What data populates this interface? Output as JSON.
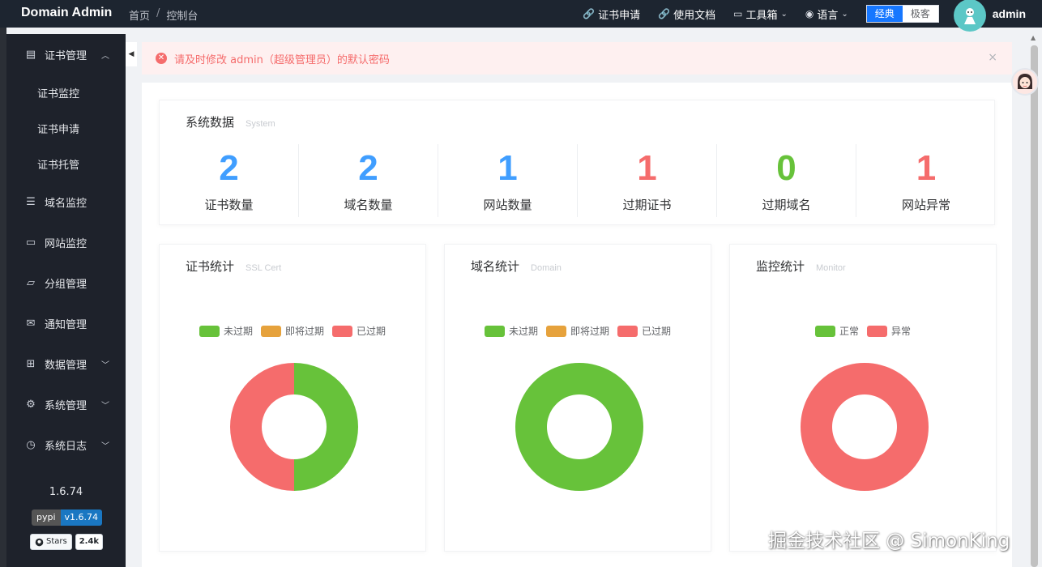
{
  "header": {
    "brand": "Domain Admin",
    "breadcrumbs": [
      "首页",
      "/",
      "控制台"
    ],
    "links": [
      {
        "label": "证书申请",
        "icon": "link-icon"
      },
      {
        "label": "使用文档",
        "icon": "link-icon"
      },
      {
        "label": "工具箱",
        "icon": "toolbox-icon"
      },
      {
        "label": "语言",
        "icon": "location-icon"
      }
    ],
    "mode": {
      "active": "经典",
      "inactive": "极客"
    },
    "username": "admin"
  },
  "sidebar": {
    "items": [
      {
        "label": "证书管理",
        "icon": "document-icon",
        "expanded": true
      },
      {
        "label": "域名监控",
        "icon": "database-icon"
      },
      {
        "label": "网站监控",
        "icon": "monitor-icon"
      },
      {
        "label": "分组管理",
        "icon": "folder-icon"
      },
      {
        "label": "通知管理",
        "icon": "mail-icon"
      },
      {
        "label": "数据管理",
        "icon": "box-icon"
      },
      {
        "label": "系统管理",
        "icon": "gear-icon"
      },
      {
        "label": "系统日志",
        "icon": "clock-icon"
      }
    ],
    "sub_items": [
      "证书监控",
      "证书申请",
      "证书托管"
    ],
    "version": "1.6.74",
    "pypi_badge": {
      "label": "pypi",
      "value": "v1.6.74"
    },
    "github_badge": {
      "label": "Stars",
      "value": "2.4k"
    }
  },
  "alert": {
    "text": "请及时修改 admin（超级管理员）的默认密码",
    "close": "×"
  },
  "system": {
    "title": "系统数据",
    "subtitle": "System",
    "stats": [
      {
        "value": "2",
        "label": "证书数量",
        "color": "#409eff"
      },
      {
        "value": "2",
        "label": "域名数量",
        "color": "#409eff"
      },
      {
        "value": "1",
        "label": "网站数量",
        "color": "#409eff"
      },
      {
        "value": "1",
        "label": "过期证书",
        "color": "#f56c6c"
      },
      {
        "value": "0",
        "label": "过期域名",
        "color": "#67c23a"
      },
      {
        "value": "1",
        "label": "网站异常",
        "color": "#f56c6c"
      }
    ]
  },
  "charts": {
    "cert": {
      "title": "证书统计",
      "subtitle": "SSL Cert"
    },
    "domain": {
      "title": "域名统计",
      "subtitle": "Domain"
    },
    "monitor": {
      "title": "监控统计",
      "subtitle": "Monitor"
    }
  },
  "chart_data": [
    {
      "type": "pie",
      "categories": [
        "未过期",
        "即将过期",
        "已过期"
      ],
      "values": [
        1,
        0,
        1
      ],
      "colors": [
        "#67c23a",
        "#e6a23c",
        "#f56c6c"
      ],
      "donut": true
    },
    {
      "type": "pie",
      "categories": [
        "未过期",
        "即将过期",
        "已过期"
      ],
      "values": [
        2,
        0,
        0
      ],
      "colors": [
        "#67c23a",
        "#e6a23c",
        "#f56c6c"
      ],
      "donut": true
    },
    {
      "type": "pie",
      "categories": [
        "正常",
        "异常"
      ],
      "values": [
        0,
        1
      ],
      "colors": [
        "#67c23a",
        "#f56c6c"
      ],
      "donut": true
    }
  ],
  "watermark": "掘金技术社区 @ SimonKing"
}
